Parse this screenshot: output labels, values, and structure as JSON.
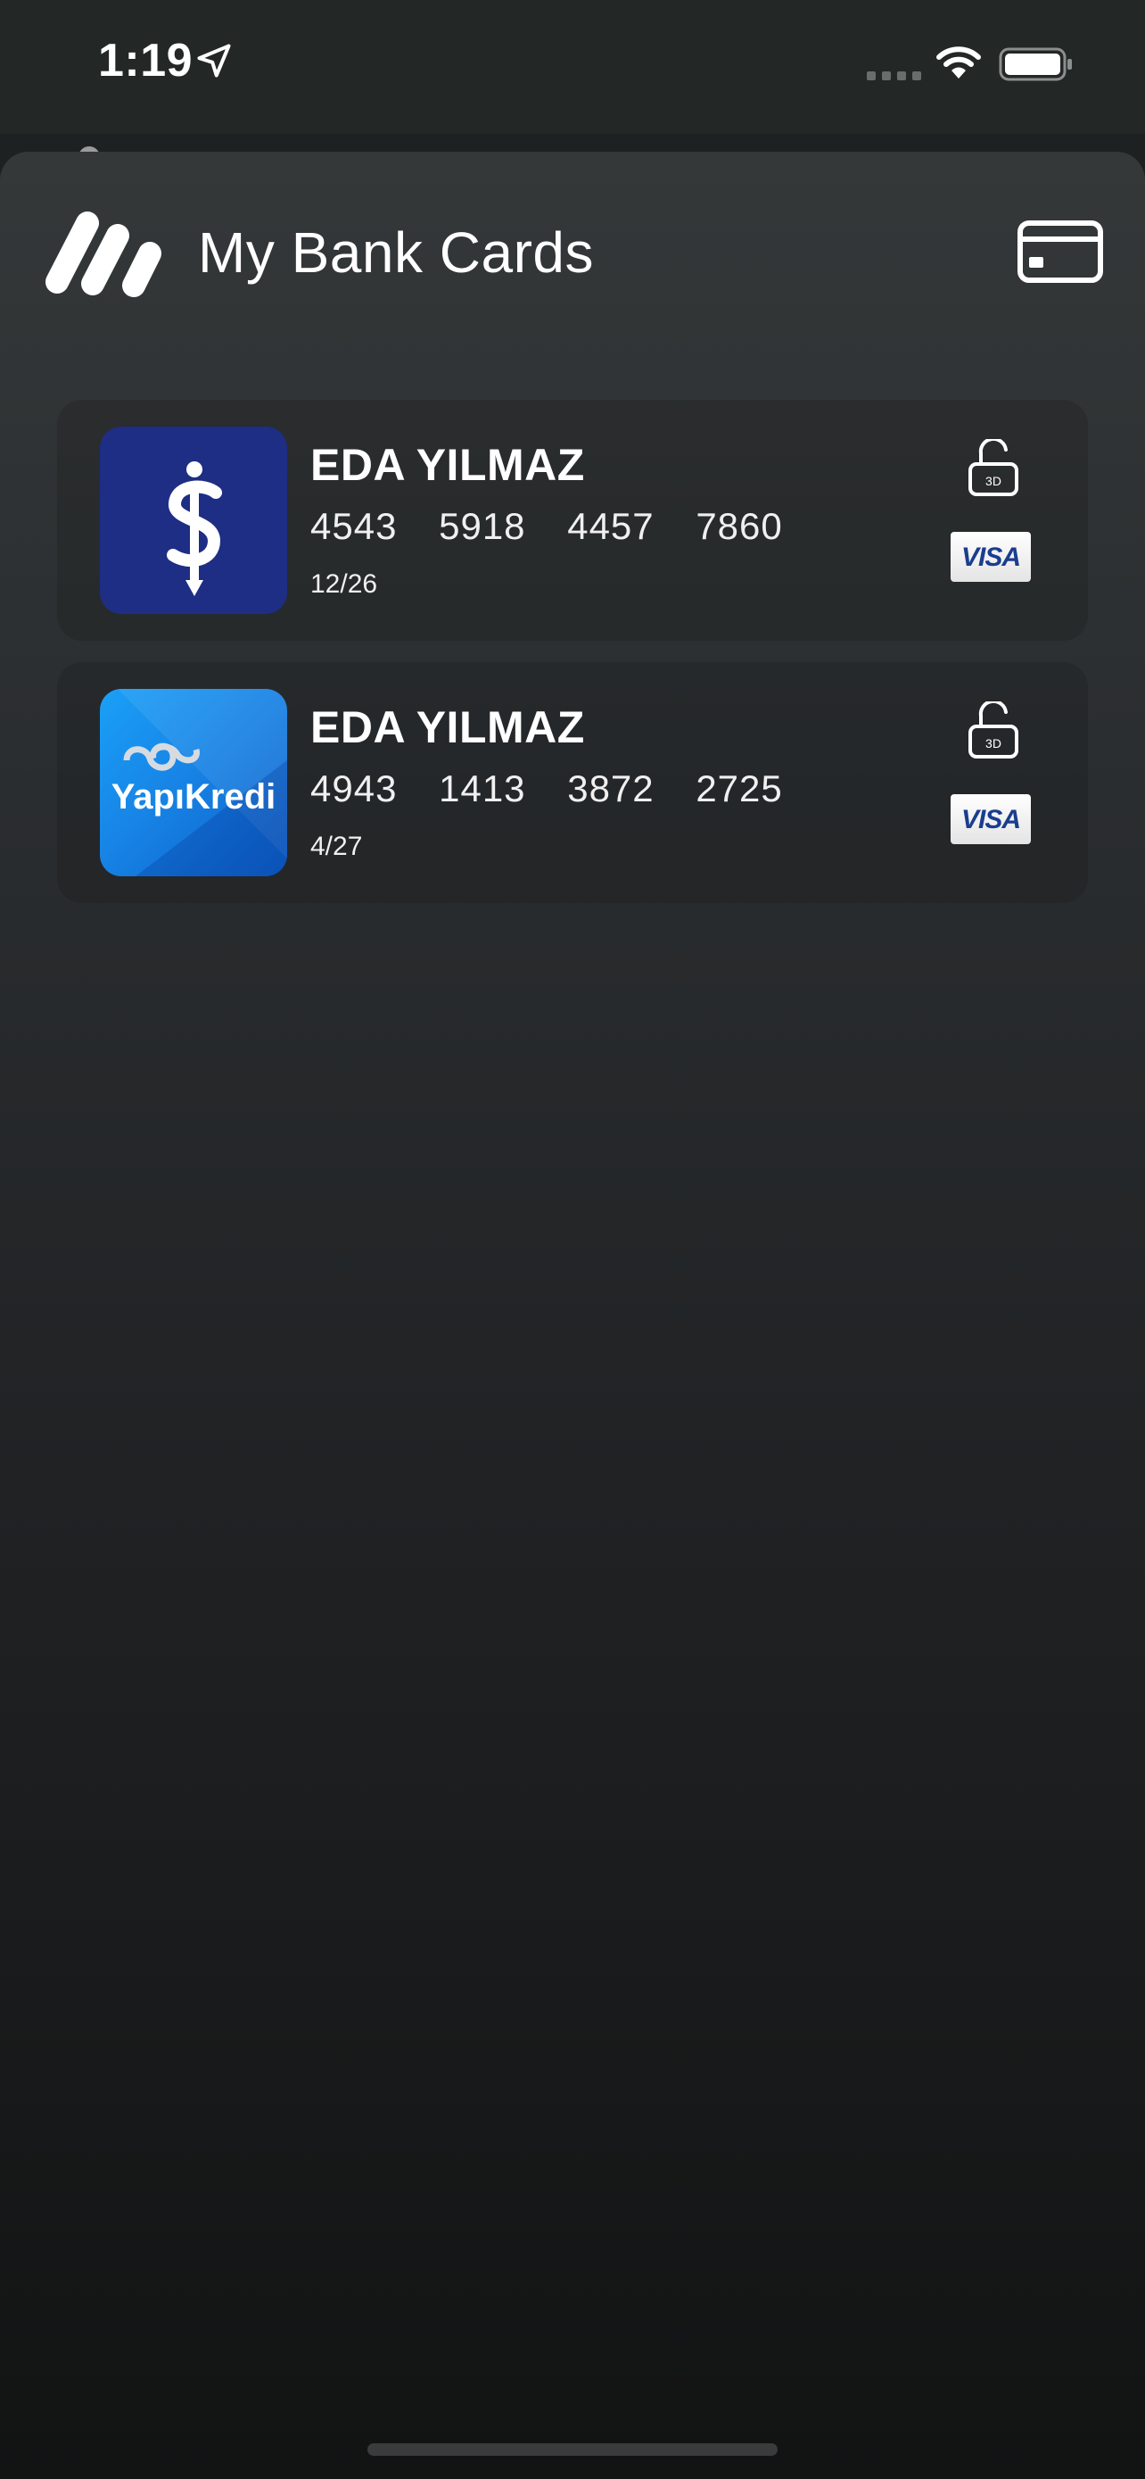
{
  "status_bar": {
    "time": "1:19",
    "icons": [
      "location-arrow-icon",
      "signal-icon",
      "wifi-icon",
      "battery-icon"
    ]
  },
  "header": {
    "title": "My Bank Cards",
    "logo_icon": "app-logo-icon",
    "add_card_icon": "credit-card-icon"
  },
  "cards": [
    {
      "bank_logo": "isbank-logo",
      "holder": "EDA YILMAZ",
      "number": [
        "4543",
        "5918",
        "4457",
        "7860"
      ],
      "expiry": "12/26",
      "secure_label": "3D",
      "network": "VISA"
    },
    {
      "bank_logo": "yapikredi-logo",
      "bank_name": "YapıKredi",
      "holder": "EDA YILMAZ",
      "number": [
        "4943",
        "1413",
        "3872",
        "2725"
      ],
      "expiry": "4/27",
      "secure_label": "3D",
      "network": "VISA"
    }
  ],
  "colors": {
    "isbank_blue": "#1e2e84",
    "yapikredi_blue": "#1784e6",
    "visa_blue": "#1a3d8f"
  }
}
